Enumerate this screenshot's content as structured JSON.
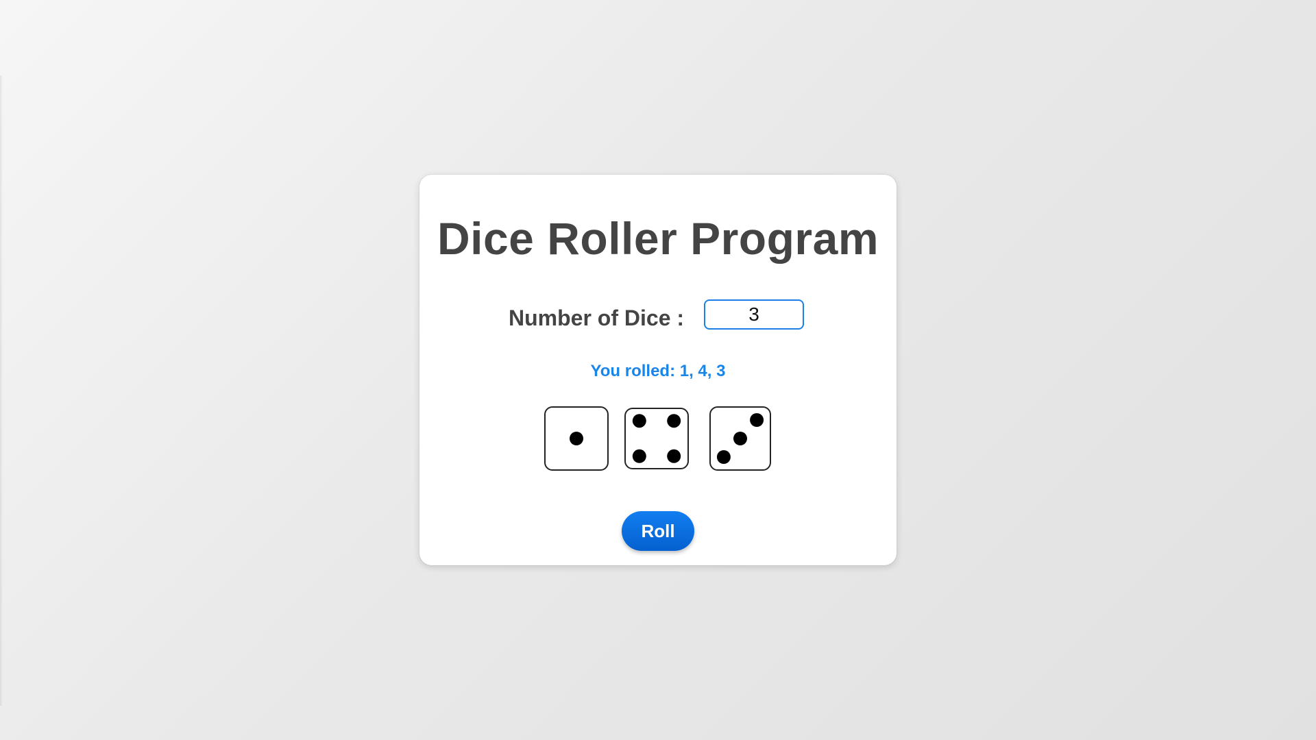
{
  "page": {
    "title": "Dice Roller Program"
  },
  "dice_count": {
    "label": "Number of Dice :",
    "value": "3"
  },
  "result": {
    "text": "You rolled: 1, 4, 3"
  },
  "dice": [
    {
      "value": 1
    },
    {
      "value": 4
    },
    {
      "value": 3
    }
  ],
  "roll_button": {
    "label": "Roll"
  },
  "colors": {
    "title": "#444444",
    "accent": "#1a85e8",
    "button": "#0a6fe0",
    "pip": "#000000"
  }
}
